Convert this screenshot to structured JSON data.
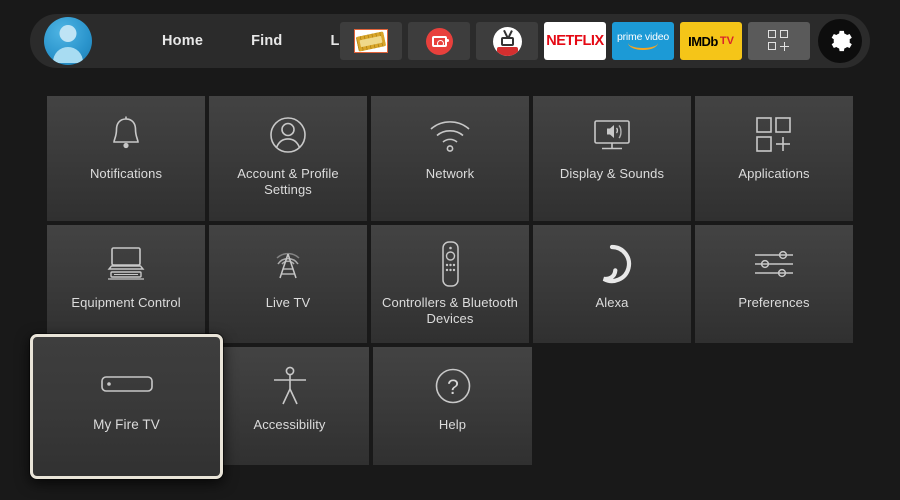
{
  "colors": {
    "page_bg": "#191919",
    "topbar_bg": "#2b2b2b",
    "tile_bg": "#3b3b3b",
    "focus_border": "#e9e4d8",
    "netflix_red": "#e50914",
    "prime_blue": "#1c9ad6",
    "imdb_yellow": "#f5c518",
    "avatar_blue": "#2a94cc"
  },
  "topbar": {
    "avatar": {
      "name": "profile-avatar"
    },
    "nav": [
      {
        "label": "Home"
      },
      {
        "label": "Find"
      },
      {
        "label": "Live"
      }
    ],
    "apps": [
      {
        "name": "cinema-ticket-app",
        "label": ""
      },
      {
        "name": "red-tv-app",
        "label": ""
      },
      {
        "name": "tv-antenna-app",
        "label": ""
      },
      {
        "name": "netflix-app",
        "label": "NETFLIX"
      },
      {
        "name": "prime-video-app",
        "label": "prime video"
      },
      {
        "name": "imdb-tv-app",
        "label": "IMDb",
        "label2": "TV"
      }
    ],
    "apps_grid_label": "",
    "settings_gear_label": ""
  },
  "grid": {
    "rows": [
      [
        {
          "label": "Notifications",
          "icon": "bell-icon"
        },
        {
          "label": "Account & Profile Settings",
          "icon": "person-circle-icon"
        },
        {
          "label": "Network",
          "icon": "wifi-icon"
        },
        {
          "label": "Display & Sounds",
          "icon": "tv-speaker-icon"
        },
        {
          "label": "Applications",
          "icon": "apps-grid-plus-icon"
        }
      ],
      [
        {
          "label": "Equipment Control",
          "icon": "monitor-device-icon"
        },
        {
          "label": "Live TV",
          "icon": "broadcast-tower-icon"
        },
        {
          "label": "Controllers & Bluetooth Devices",
          "icon": "remote-control-icon"
        },
        {
          "label": "Alexa",
          "icon": "alexa-ring-icon"
        },
        {
          "label": "Preferences",
          "icon": "sliders-icon"
        }
      ],
      [
        {
          "label": "My Fire TV",
          "icon": "fire-tv-stick-icon",
          "focused": true
        },
        {
          "label": "Accessibility",
          "icon": "accessibility-person-icon"
        },
        {
          "label": "Help",
          "icon": "question-circle-icon"
        }
      ]
    ]
  }
}
